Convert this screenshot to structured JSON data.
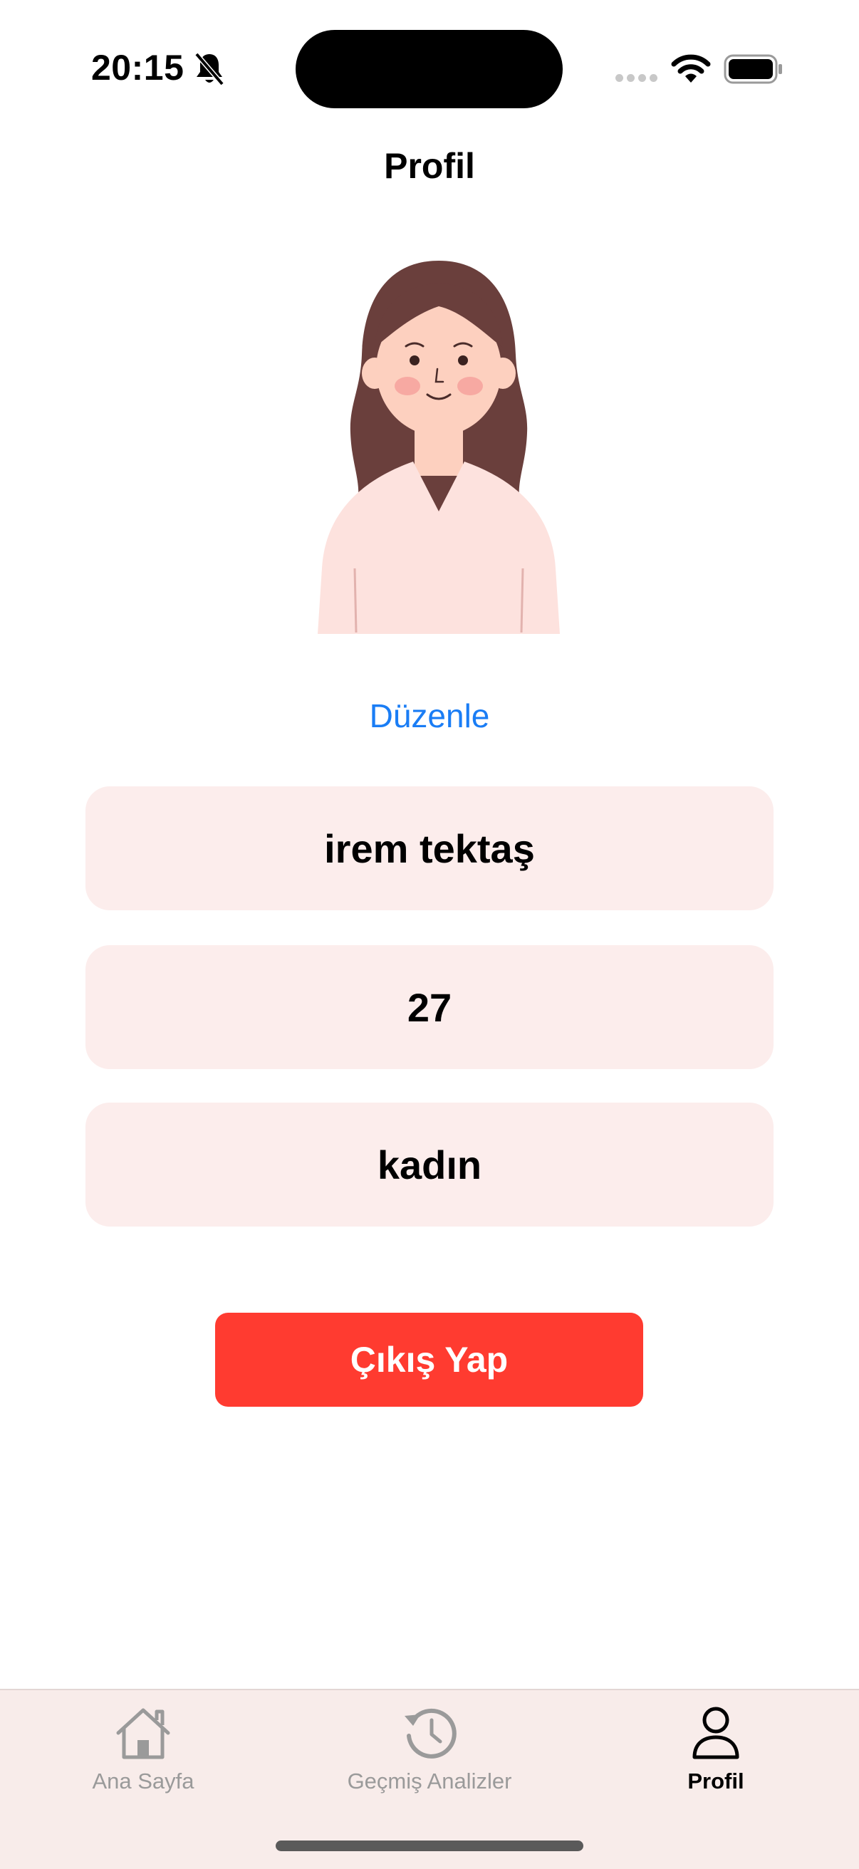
{
  "status_bar": {
    "time": "20:15",
    "icons": [
      "bell-slash-icon",
      "signal-dots-icon",
      "wifi-icon",
      "battery-icon"
    ]
  },
  "header": {
    "title": "Profil"
  },
  "profile": {
    "avatar": "woman-avatar-illustration",
    "edit_label": "Düzenle",
    "name": "irem tektaş",
    "age": "27",
    "gender": "kadın"
  },
  "actions": {
    "logout_label": "Çıkış Yap"
  },
  "tab_bar": {
    "tabs": [
      {
        "label": "Ana Sayfa",
        "icon": "house-icon",
        "active": false
      },
      {
        "label": "Geçmiş Analizler",
        "icon": "history-clock-icon",
        "active": false
      },
      {
        "label": "Profil",
        "icon": "person-icon",
        "active": true
      }
    ]
  },
  "colors": {
    "accent_link": "#1a7df5",
    "logout_red": "#ff3b30",
    "field_background": "#fcedec",
    "tab_bar_background": "#f8ecea",
    "inactive_tab": "#9a9a9a"
  }
}
